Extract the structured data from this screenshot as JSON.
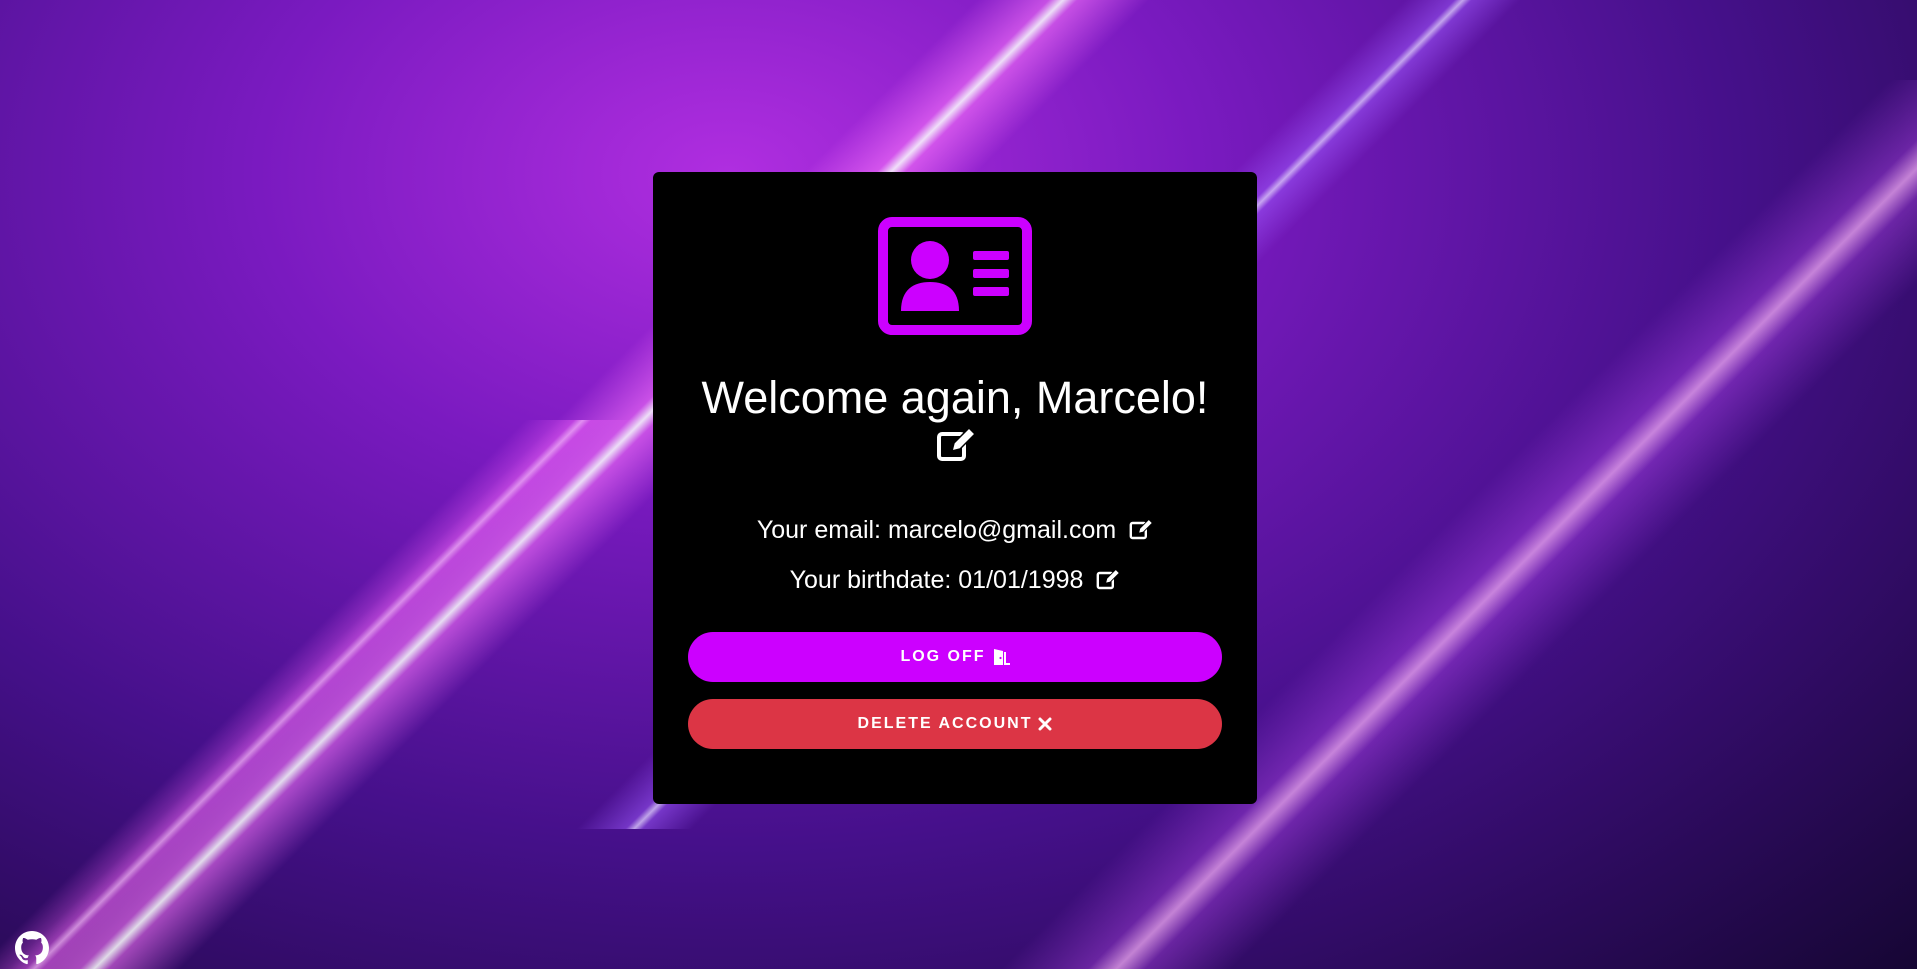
{
  "profile": {
    "icon": "id-card-icon",
    "welcome_text": "Welcome again, Marcelo!",
    "email_label": "Your email:",
    "email_value": "marcelo@gmail.com",
    "birthdate_label": "Your birthdate:",
    "birthdate_value": "01/01/1998",
    "edit_icon": "edit-icon"
  },
  "buttons": {
    "logoff_label": "LOG OFF",
    "logoff_icon": "door-open-icon",
    "delete_label": "DELETE ACCOUNT",
    "delete_icon": "times-icon"
  },
  "footer": {
    "github_icon": "github-icon"
  },
  "colors": {
    "accent": "#cc00ff",
    "danger": "#dc3545",
    "card_bg": "#000000",
    "text": "#ffffff"
  }
}
